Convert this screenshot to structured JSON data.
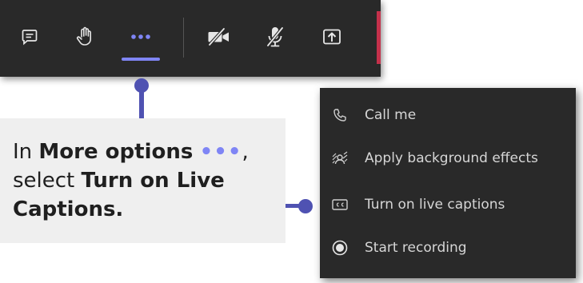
{
  "toolbar": {
    "buttons": [
      {
        "name": "chat",
        "icon": "chat-icon"
      },
      {
        "name": "raise-hand",
        "icon": "raise-hand-icon"
      },
      {
        "name": "more-options",
        "icon": "more-options-icon",
        "active": true
      },
      {
        "name": "camera",
        "icon": "camera-off-icon"
      },
      {
        "name": "mic",
        "icon": "mic-off-icon"
      },
      {
        "name": "share",
        "icon": "share-screen-icon"
      }
    ],
    "accent_color": "#7f85f5",
    "end_call_color": "#c4314b"
  },
  "callout": {
    "text_1": "In ",
    "bold_1": "More options",
    "dots": "•••",
    "text_2": ",",
    "text_3": "select ",
    "bold_2": "Turn on Live Captions."
  },
  "menu": {
    "items": [
      {
        "label": "Call me",
        "icon": "phone-icon"
      },
      {
        "label": "Apply background effects",
        "icon": "background-effects-icon"
      },
      {
        "label": "Turn on live captions",
        "icon": "closed-captions-icon"
      },
      {
        "label": "Start recording",
        "icon": "record-icon"
      }
    ]
  },
  "colors": {
    "connector": "#4f52b2",
    "panel": "#292929",
    "callout_bg": "#efefef"
  }
}
